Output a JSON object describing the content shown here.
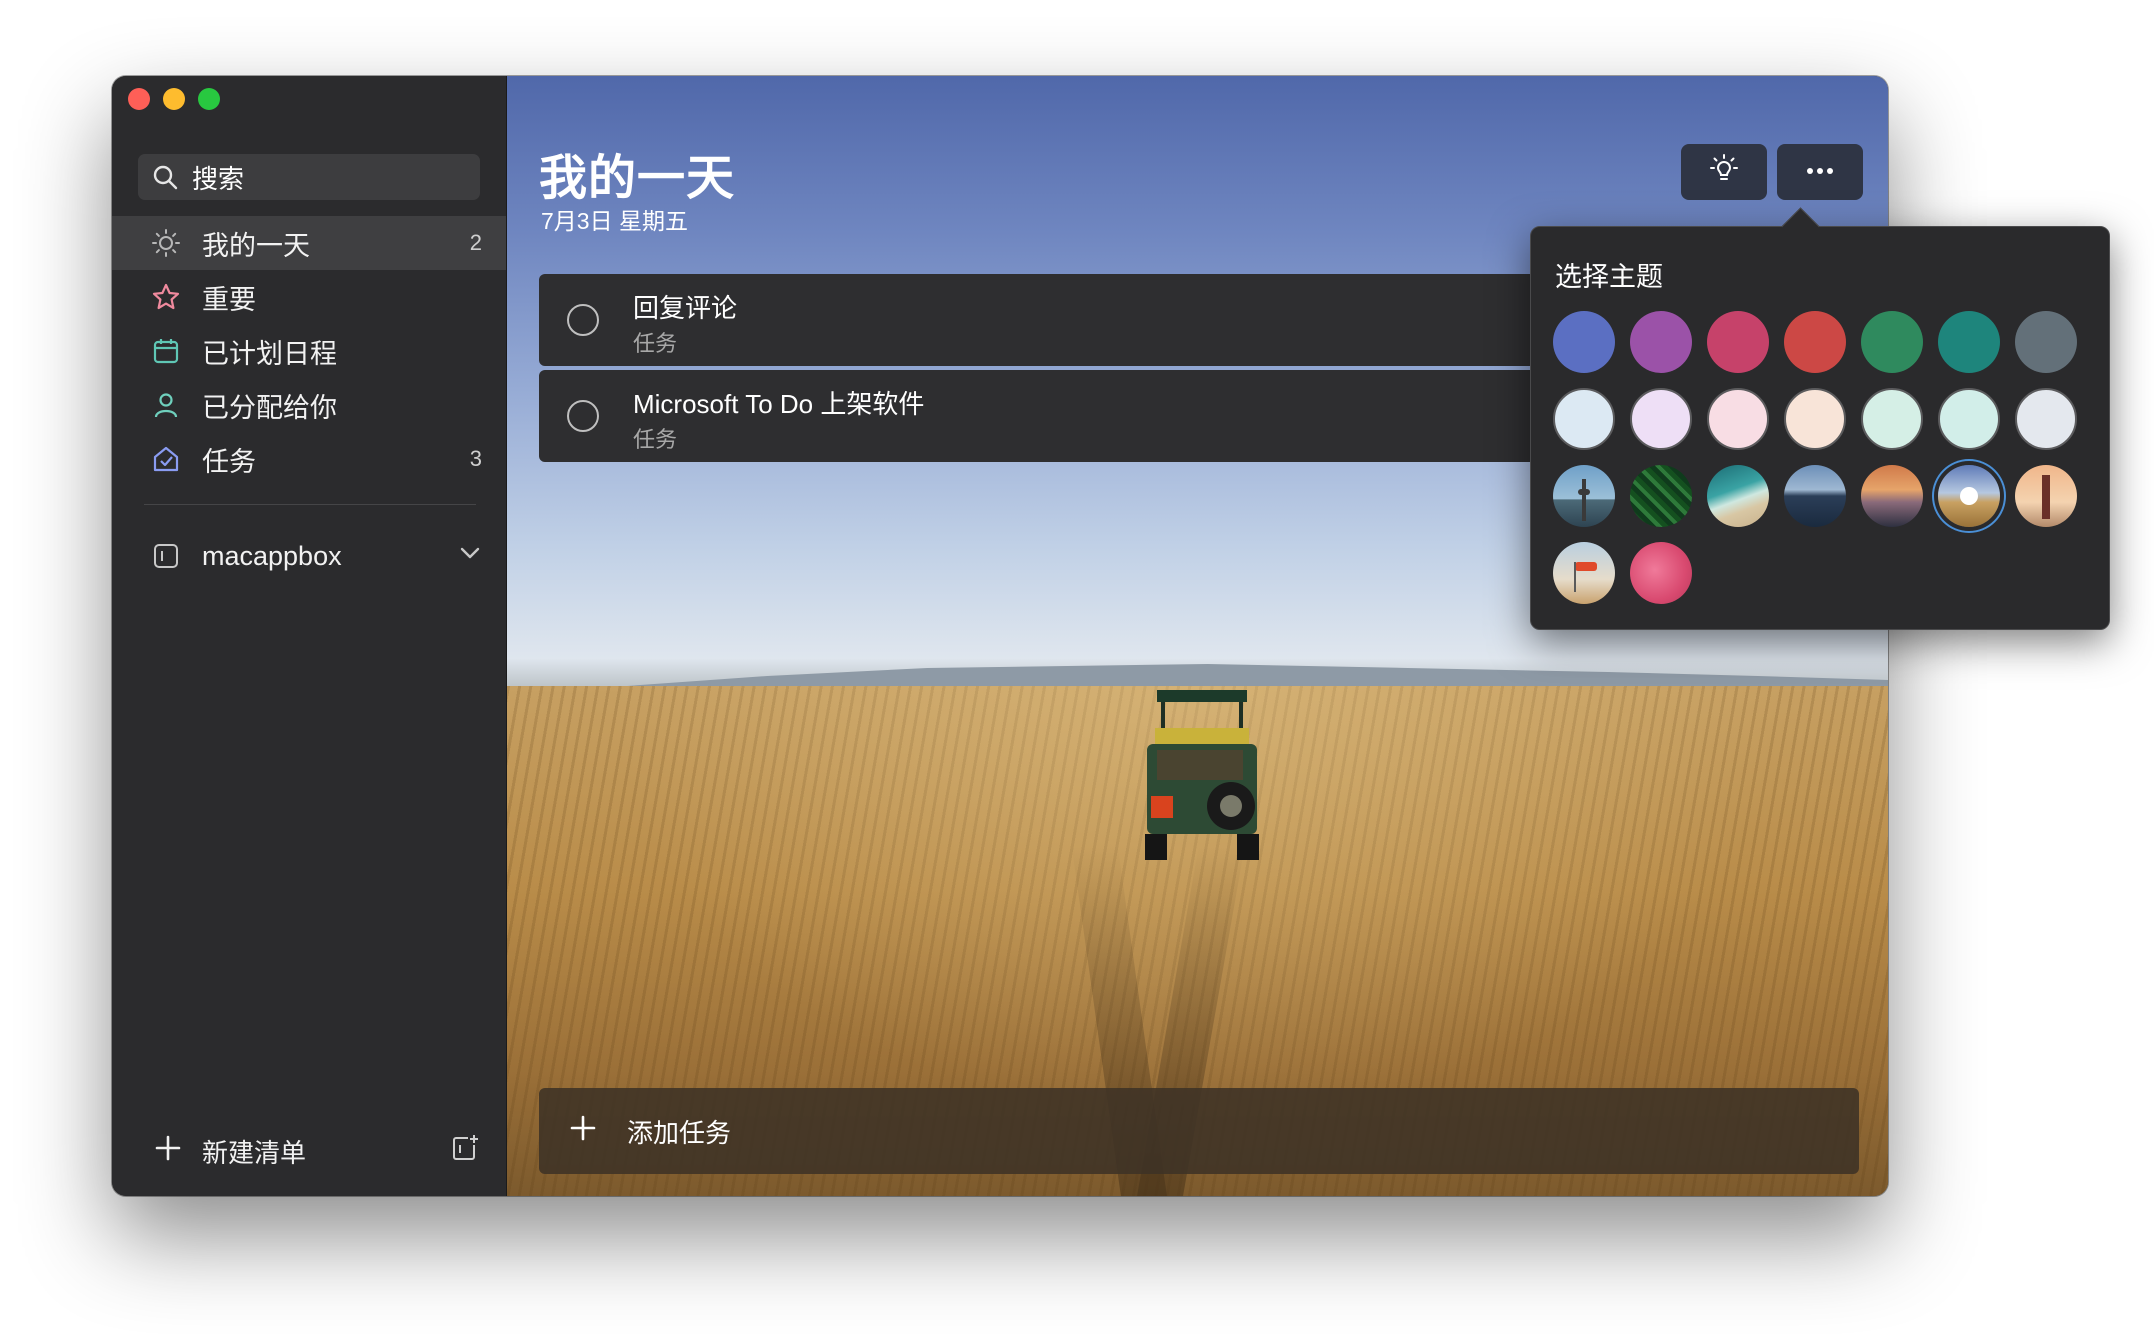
{
  "window": {
    "traffic_lights": [
      "#fe5f57",
      "#febc2e",
      "#28c840"
    ]
  },
  "sidebar": {
    "search_label": "搜索",
    "items": [
      {
        "label": "我的一天",
        "count": "2",
        "icon": "sun-icon",
        "color": "#b8b8b8",
        "active": true
      },
      {
        "label": "重要",
        "count": "",
        "icon": "star-icon",
        "color": "#f08a9e",
        "active": false
      },
      {
        "label": "已计划日程",
        "count": "",
        "icon": "calendar-icon",
        "color": "#5fc7b5",
        "active": false
      },
      {
        "label": "已分配给你",
        "count": "",
        "icon": "person-icon",
        "color": "#6fd0bd",
        "active": false
      },
      {
        "label": "任务",
        "count": "3",
        "icon": "home-icon",
        "color": "#8a9cf2",
        "active": false
      }
    ],
    "group": {
      "label": "macappbox",
      "icon": "group-icon",
      "chevron": "chevron-down-icon"
    },
    "new_list_label": "新建清单"
  },
  "main": {
    "title": "我的一天",
    "date": "7月3日 星期五",
    "toolbar_icons": [
      "lightbulb-icon",
      "more-icon"
    ],
    "tasks": [
      {
        "title": "回复评论",
        "list": "任务"
      },
      {
        "title": "Microsoft To Do 上架软件",
        "list": "任务"
      }
    ],
    "add_task_label": "添加任务"
  },
  "theme_popover": {
    "title": "选择主题",
    "colors": [
      "#5b6fc2",
      "#9b52a8",
      "#c6426a",
      "#cc4845",
      "#2f8a5e",
      "#1e857c",
      "#637079"
    ],
    "light_colors": [
      "#dce9f3",
      "#eedff6",
      "#f8dde4",
      "#f8e4d8",
      "#d5efe6",
      "#d2eee9",
      "#e4e8ee"
    ],
    "photos": [
      "city-tower-photo",
      "palm-leaves-photo",
      "beach-waves-photo",
      "mountain-lake-photo",
      "sunset-palm-photo",
      "savanna-jeep-photo",
      "lighthouse-photo",
      "windsock-photo",
      "pink-abstract-photo"
    ],
    "selected_photo_index": 5
  }
}
